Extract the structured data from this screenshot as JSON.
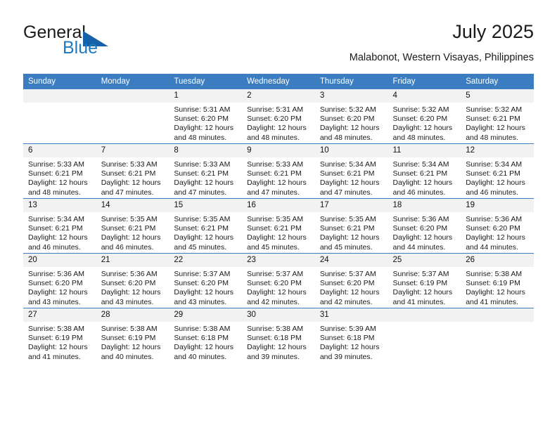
{
  "brand": {
    "name_part1": "General",
    "name_part2": "Blue",
    "triangle_icon": "triangle-icon",
    "accent_color": "#1562a8",
    "blue_text_color": "#1f7ac4"
  },
  "header": {
    "month_title": "July 2025",
    "location": "Malabonot, Western Visayas, Philippines"
  },
  "calendar": {
    "header_bg": "#3b7dc0",
    "daynum_bg": "#f2f2f2",
    "weekday_headers": [
      "Sunday",
      "Monday",
      "Tuesday",
      "Wednesday",
      "Thursday",
      "Friday",
      "Saturday"
    ],
    "weeks": [
      [
        {
          "day": "",
          "sunrise": "",
          "sunset": "",
          "daylight_line1": "",
          "daylight_line2": "",
          "blank": true
        },
        {
          "day": "",
          "sunrise": "",
          "sunset": "",
          "daylight_line1": "",
          "daylight_line2": "",
          "blank": true
        },
        {
          "day": "1",
          "sunrise": "Sunrise: 5:31 AM",
          "sunset": "Sunset: 6:20 PM",
          "daylight_line1": "Daylight: 12 hours",
          "daylight_line2": "and 48 minutes."
        },
        {
          "day": "2",
          "sunrise": "Sunrise: 5:31 AM",
          "sunset": "Sunset: 6:20 PM",
          "daylight_line1": "Daylight: 12 hours",
          "daylight_line2": "and 48 minutes."
        },
        {
          "day": "3",
          "sunrise": "Sunrise: 5:32 AM",
          "sunset": "Sunset: 6:20 PM",
          "daylight_line1": "Daylight: 12 hours",
          "daylight_line2": "and 48 minutes."
        },
        {
          "day": "4",
          "sunrise": "Sunrise: 5:32 AM",
          "sunset": "Sunset: 6:20 PM",
          "daylight_line1": "Daylight: 12 hours",
          "daylight_line2": "and 48 minutes."
        },
        {
          "day": "5",
          "sunrise": "Sunrise: 5:32 AM",
          "sunset": "Sunset: 6:21 PM",
          "daylight_line1": "Daylight: 12 hours",
          "daylight_line2": "and 48 minutes."
        }
      ],
      [
        {
          "day": "6",
          "sunrise": "Sunrise: 5:33 AM",
          "sunset": "Sunset: 6:21 PM",
          "daylight_line1": "Daylight: 12 hours",
          "daylight_line2": "and 48 minutes."
        },
        {
          "day": "7",
          "sunrise": "Sunrise: 5:33 AM",
          "sunset": "Sunset: 6:21 PM",
          "daylight_line1": "Daylight: 12 hours",
          "daylight_line2": "and 47 minutes."
        },
        {
          "day": "8",
          "sunrise": "Sunrise: 5:33 AM",
          "sunset": "Sunset: 6:21 PM",
          "daylight_line1": "Daylight: 12 hours",
          "daylight_line2": "and 47 minutes."
        },
        {
          "day": "9",
          "sunrise": "Sunrise: 5:33 AM",
          "sunset": "Sunset: 6:21 PM",
          "daylight_line1": "Daylight: 12 hours",
          "daylight_line2": "and 47 minutes."
        },
        {
          "day": "10",
          "sunrise": "Sunrise: 5:34 AM",
          "sunset": "Sunset: 6:21 PM",
          "daylight_line1": "Daylight: 12 hours",
          "daylight_line2": "and 47 minutes."
        },
        {
          "day": "11",
          "sunrise": "Sunrise: 5:34 AM",
          "sunset": "Sunset: 6:21 PM",
          "daylight_line1": "Daylight: 12 hours",
          "daylight_line2": "and 46 minutes."
        },
        {
          "day": "12",
          "sunrise": "Sunrise: 5:34 AM",
          "sunset": "Sunset: 6:21 PM",
          "daylight_line1": "Daylight: 12 hours",
          "daylight_line2": "and 46 minutes."
        }
      ],
      [
        {
          "day": "13",
          "sunrise": "Sunrise: 5:34 AM",
          "sunset": "Sunset: 6:21 PM",
          "daylight_line1": "Daylight: 12 hours",
          "daylight_line2": "and 46 minutes."
        },
        {
          "day": "14",
          "sunrise": "Sunrise: 5:35 AM",
          "sunset": "Sunset: 6:21 PM",
          "daylight_line1": "Daylight: 12 hours",
          "daylight_line2": "and 46 minutes."
        },
        {
          "day": "15",
          "sunrise": "Sunrise: 5:35 AM",
          "sunset": "Sunset: 6:21 PM",
          "daylight_line1": "Daylight: 12 hours",
          "daylight_line2": "and 45 minutes."
        },
        {
          "day": "16",
          "sunrise": "Sunrise: 5:35 AM",
          "sunset": "Sunset: 6:21 PM",
          "daylight_line1": "Daylight: 12 hours",
          "daylight_line2": "and 45 minutes."
        },
        {
          "day": "17",
          "sunrise": "Sunrise: 5:35 AM",
          "sunset": "Sunset: 6:21 PM",
          "daylight_line1": "Daylight: 12 hours",
          "daylight_line2": "and 45 minutes."
        },
        {
          "day": "18",
          "sunrise": "Sunrise: 5:36 AM",
          "sunset": "Sunset: 6:20 PM",
          "daylight_line1": "Daylight: 12 hours",
          "daylight_line2": "and 44 minutes."
        },
        {
          "day": "19",
          "sunrise": "Sunrise: 5:36 AM",
          "sunset": "Sunset: 6:20 PM",
          "daylight_line1": "Daylight: 12 hours",
          "daylight_line2": "and 44 minutes."
        }
      ],
      [
        {
          "day": "20",
          "sunrise": "Sunrise: 5:36 AM",
          "sunset": "Sunset: 6:20 PM",
          "daylight_line1": "Daylight: 12 hours",
          "daylight_line2": "and 43 minutes."
        },
        {
          "day": "21",
          "sunrise": "Sunrise: 5:36 AM",
          "sunset": "Sunset: 6:20 PM",
          "daylight_line1": "Daylight: 12 hours",
          "daylight_line2": "and 43 minutes."
        },
        {
          "day": "22",
          "sunrise": "Sunrise: 5:37 AM",
          "sunset": "Sunset: 6:20 PM",
          "daylight_line1": "Daylight: 12 hours",
          "daylight_line2": "and 43 minutes."
        },
        {
          "day": "23",
          "sunrise": "Sunrise: 5:37 AM",
          "sunset": "Sunset: 6:20 PM",
          "daylight_line1": "Daylight: 12 hours",
          "daylight_line2": "and 42 minutes."
        },
        {
          "day": "24",
          "sunrise": "Sunrise: 5:37 AM",
          "sunset": "Sunset: 6:20 PM",
          "daylight_line1": "Daylight: 12 hours",
          "daylight_line2": "and 42 minutes."
        },
        {
          "day": "25",
          "sunrise": "Sunrise: 5:37 AM",
          "sunset": "Sunset: 6:19 PM",
          "daylight_line1": "Daylight: 12 hours",
          "daylight_line2": "and 41 minutes."
        },
        {
          "day": "26",
          "sunrise": "Sunrise: 5:38 AM",
          "sunset": "Sunset: 6:19 PM",
          "daylight_line1": "Daylight: 12 hours",
          "daylight_line2": "and 41 minutes."
        }
      ],
      [
        {
          "day": "27",
          "sunrise": "Sunrise: 5:38 AM",
          "sunset": "Sunset: 6:19 PM",
          "daylight_line1": "Daylight: 12 hours",
          "daylight_line2": "and 41 minutes."
        },
        {
          "day": "28",
          "sunrise": "Sunrise: 5:38 AM",
          "sunset": "Sunset: 6:19 PM",
          "daylight_line1": "Daylight: 12 hours",
          "daylight_line2": "and 40 minutes."
        },
        {
          "day": "29",
          "sunrise": "Sunrise: 5:38 AM",
          "sunset": "Sunset: 6:18 PM",
          "daylight_line1": "Daylight: 12 hours",
          "daylight_line2": "and 40 minutes."
        },
        {
          "day": "30",
          "sunrise": "Sunrise: 5:38 AM",
          "sunset": "Sunset: 6:18 PM",
          "daylight_line1": "Daylight: 12 hours",
          "daylight_line2": "and 39 minutes."
        },
        {
          "day": "31",
          "sunrise": "Sunrise: 5:39 AM",
          "sunset": "Sunset: 6:18 PM",
          "daylight_line1": "Daylight: 12 hours",
          "daylight_line2": "and 39 minutes."
        },
        {
          "day": "",
          "sunrise": "",
          "sunset": "",
          "daylight_line1": "",
          "daylight_line2": "",
          "blank": true
        },
        {
          "day": "",
          "sunrise": "",
          "sunset": "",
          "daylight_line1": "",
          "daylight_line2": "",
          "blank": true
        }
      ]
    ]
  }
}
